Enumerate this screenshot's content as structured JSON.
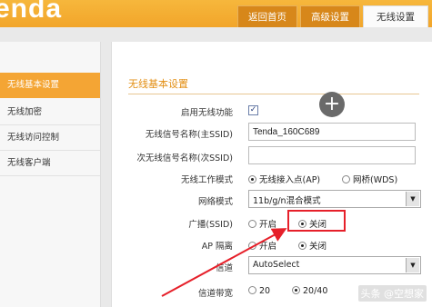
{
  "header": {
    "logo": "Tenda 腾达",
    "tabs": [
      {
        "label": "返回首页",
        "active": false
      },
      {
        "label": "高级设置",
        "active": false
      },
      {
        "label": "无线设置",
        "active": true
      }
    ]
  },
  "sidebar": {
    "items": [
      {
        "label": "无线基本设置",
        "active": true
      },
      {
        "label": "无线加密",
        "active": false
      },
      {
        "label": "无线访问控制",
        "active": false
      },
      {
        "label": "无线客户端",
        "active": false
      }
    ]
  },
  "main": {
    "section_title": "无线基本设置",
    "enable_wireless": {
      "label": "启用无线功能",
      "checked": true,
      "check_glyph": "✓"
    },
    "primary_ssid": {
      "label": "无线信号名称(主SSID)",
      "value": "Tenda_160C689"
    },
    "secondary_ssid": {
      "label": "次无线信号名称(次SSID)",
      "value": ""
    },
    "work_mode": {
      "label": "无线工作模式",
      "options": [
        "无线接入点(AP)",
        "网桥(WDS)"
      ],
      "selected": 0
    },
    "network_mode": {
      "label": "网络模式",
      "value": "11b/g/n混合模式"
    },
    "broadcast": {
      "label": "广播(SSID)",
      "options": [
        "开启",
        "关闭"
      ],
      "selected": 1
    },
    "ap_isolation": {
      "label": "AP 隔离",
      "options": [
        "开启",
        "关闭"
      ],
      "selected": 1
    },
    "channel": {
      "label": "信道",
      "value": "AutoSelect"
    },
    "bandwidth": {
      "label": "信道带宽",
      "options": [
        "20",
        "20/40"
      ],
      "selected": 1
    },
    "plus_glyph": "+"
  },
  "watermark": "头条 @空想家",
  "colors": {
    "brand_orange": "#f2a52a",
    "annotation_red": "#e6202a"
  }
}
